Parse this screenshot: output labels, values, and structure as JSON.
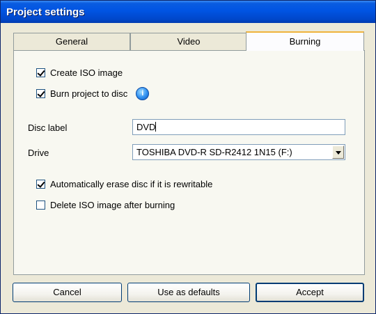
{
  "window": {
    "title": "Project settings"
  },
  "tabs": [
    {
      "label": "General",
      "selected": false
    },
    {
      "label": "Video",
      "selected": false
    },
    {
      "label": "Burning",
      "selected": true
    }
  ],
  "burning": {
    "create_iso": {
      "label": "Create ISO image",
      "checked": true
    },
    "burn_project": {
      "label": "Burn project to disc",
      "checked": true,
      "info_icon": "info-icon"
    },
    "disc_label": {
      "label": "Disc label",
      "value": "DVD"
    },
    "drive": {
      "label": "Drive",
      "value": "TOSHIBA DVD-R SD-R2412 1N15 (F:)"
    },
    "auto_erase": {
      "label": "Automatically erase disc if it is rewritable",
      "checked": true
    },
    "delete_iso": {
      "label": "Delete ISO image after burning",
      "checked": false
    }
  },
  "buttons": {
    "cancel": "Cancel",
    "defaults": "Use as defaults",
    "accept": "Accept"
  },
  "colors": {
    "titlebar": "#0054e3",
    "tab_accent": "#f0b33c",
    "dialog_bg": "#ece9d8"
  }
}
